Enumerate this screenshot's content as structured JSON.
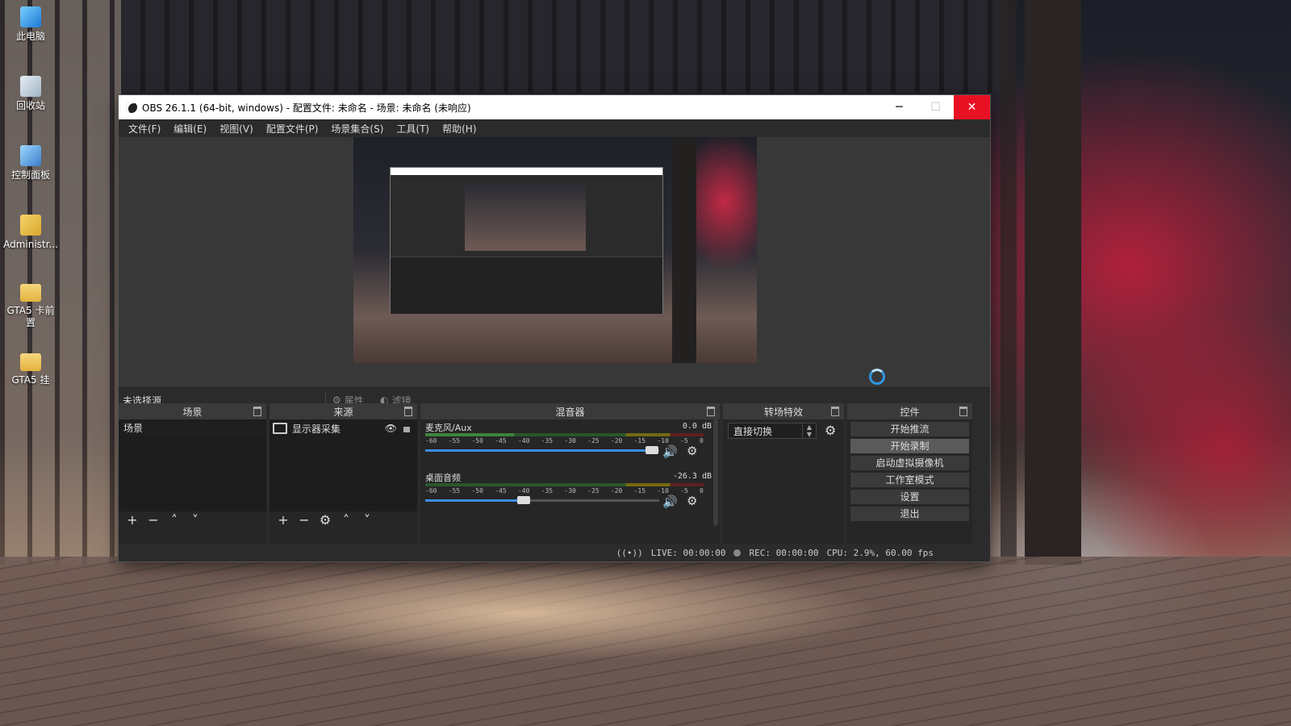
{
  "desktop": {
    "icons": [
      {
        "label": "此电脑",
        "icon": "computer-icon"
      },
      {
        "label": "回收站",
        "icon": "recycle-bin-icon"
      },
      {
        "label": "控制面板",
        "icon": "control-panel-icon"
      },
      {
        "label": "Administr...",
        "icon": "user-folder-icon"
      },
      {
        "label": "GTA5 卡前置",
        "icon": "folder-icon"
      },
      {
        "label": "GTA5 挂",
        "icon": "folder-icon"
      }
    ]
  },
  "window": {
    "title": "OBS 26.1.1 (64-bit, windows) - 配置文件: 未命名 - 场景: 未命名 (未响应)",
    "controls": {
      "minimize": "─",
      "maximize": "☐",
      "close": "✕"
    }
  },
  "menu": [
    "文件(F)",
    "编辑(E)",
    "视图(V)",
    "配置文件(P)",
    "场景集合(S)",
    "工具(T)",
    "帮助(H)"
  ],
  "source_bar": {
    "no_selection": "未选择源",
    "properties": "属性",
    "filters": "滤镜"
  },
  "docks": {
    "scenes": {
      "title": "场景",
      "items": [
        "场景"
      ]
    },
    "sources": {
      "title": "来源",
      "items": [
        {
          "name": "显示器采集",
          "icon": "monitor-icon"
        }
      ]
    },
    "mixer": {
      "title": "混音器",
      "scale": [
        "-60",
        "-55",
        "-50",
        "-45",
        "-40",
        "-35",
        "-30",
        "-25",
        "-20",
        "-15",
        "-10",
        "-5",
        "0"
      ],
      "channels": [
        {
          "name": "麦克风/Aux",
          "db": "0.0 dB",
          "level": 0.32,
          "volume": 0.97
        },
        {
          "name": "桌面音频",
          "db": "-26.3 dB",
          "level": 0.0,
          "volume": 0.42
        }
      ]
    },
    "transitions": {
      "title": "转场特效",
      "selected": "直接切换"
    },
    "controls": {
      "title": "控件",
      "buttons": [
        "开始推流",
        "开始录制",
        "启动虚拟摄像机",
        "工作室模式",
        "设置",
        "退出"
      ]
    }
  },
  "status": {
    "live": "LIVE: 00:00:00",
    "rec": "REC: 00:00:00",
    "cpu": "CPU: 2.9%, 60.00 fps"
  },
  "colors": {
    "accent": "#3a8ee6",
    "close": "#e81123",
    "meter_green": "#4ecf4e"
  }
}
